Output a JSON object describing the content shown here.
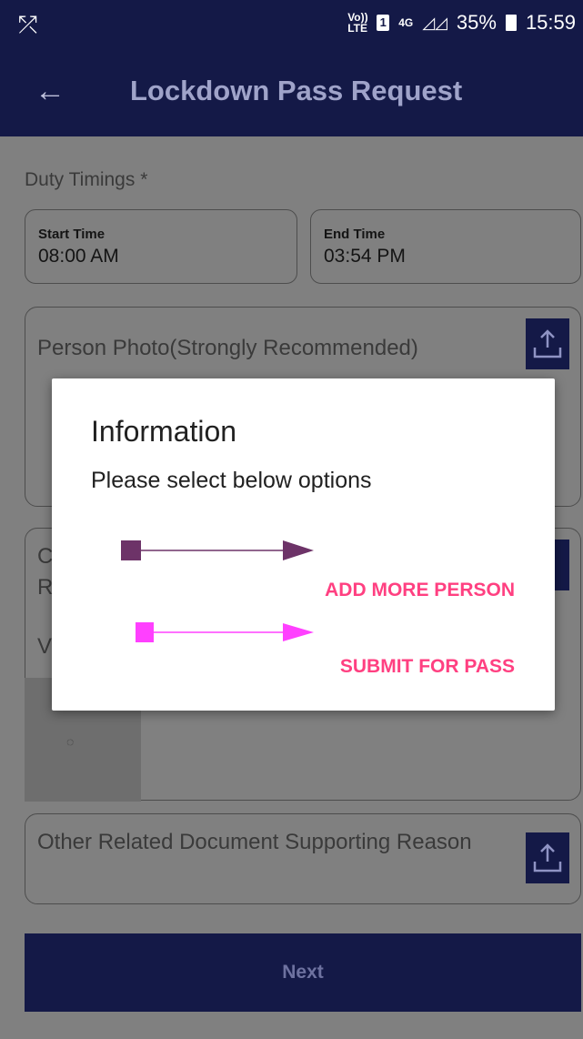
{
  "status_bar": {
    "carrier_icon": "missed-call-icon",
    "volte": "Vo)) LTE",
    "sim": "1",
    "network": "4G",
    "battery": "35%",
    "time": "15:59"
  },
  "app_bar": {
    "back_icon": "arrow-left-icon",
    "title": "Lockdown Pass Request"
  },
  "form": {
    "duty_timings_label": "Duty Timings *",
    "start_time_label": "Start Time",
    "start_time_value": "08:00 AM",
    "end_time_label": "End Time",
    "end_time_value": "03:54 PM",
    "person_photo_label": "Person Photo(Strongly Recommended)",
    "second_card_partial_line1": "C",
    "second_card_partial_line2": "R",
    "second_card_partial_line3": "V",
    "other_document_label": "Other Related Document Supporting Reason",
    "next_label": "Next"
  },
  "dialog": {
    "title": "Information",
    "message": "Please select below options",
    "add_more_label": "ADD MORE PERSON",
    "submit_label": "SUBMIT FOR PASS"
  },
  "colors": {
    "primary": "#141947",
    "accent": "#ff4081",
    "arrow_1": "#6d3368",
    "arrow_2": "#ff40ff"
  }
}
